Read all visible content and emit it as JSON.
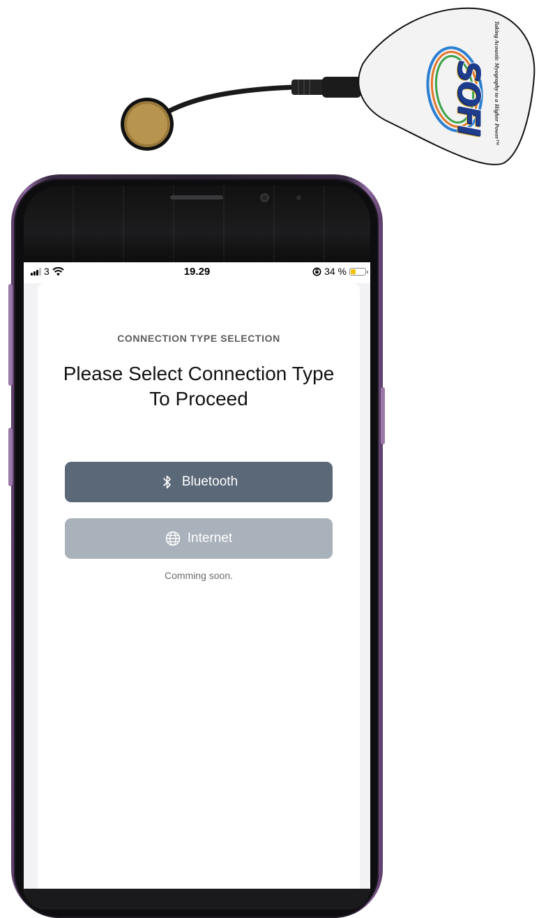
{
  "device": {
    "brand_logo": "SOFI",
    "tagline": "Taking Acoustic Myography to a Higher Power™"
  },
  "status_bar": {
    "carrier": "3",
    "time": "19.29",
    "battery_percent": "34 %",
    "battery_level": 0.34,
    "icons": [
      "signal-icon",
      "wifi-icon",
      "rotation-lock-icon",
      "battery-icon"
    ]
  },
  "screen": {
    "eyebrow": "CONNECTION TYPE SELECTION",
    "headline_line1": "Please Select Connection Type",
    "headline_line2": "To Proceed",
    "bluetooth_label": "Bluetooth",
    "internet_label": "Internet",
    "internet_note": "Comming soon."
  },
  "colors": {
    "bluetooth_button": "#5a6878",
    "internet_button_disabled": "#a9b1ba",
    "phone_frame": "#8d6aa0",
    "battery_fill": "#f4c400"
  }
}
